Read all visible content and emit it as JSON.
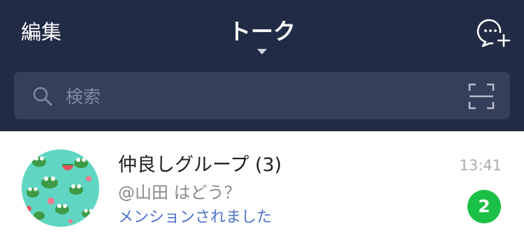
{
  "header": {
    "edit_label": "編集",
    "title": "トーク",
    "new_chat_icon": "chat-bubble-plus-icon",
    "background_color": "#222b45"
  },
  "search": {
    "placeholder": "検索",
    "value": "",
    "search_icon": "search-icon",
    "scan_icon": "qr-scan-icon",
    "background_color": "#363f5a"
  },
  "chats": [
    {
      "name": "仲良しグループ (3)",
      "preview": "@山田 はどう？",
      "mention_note": "メンションされました",
      "time": "13:41",
      "unread_count": "2",
      "avatar": "group-frog-avatar",
      "mention_color": "#4a73c9",
      "badge_color": "#1bc147"
    }
  ]
}
